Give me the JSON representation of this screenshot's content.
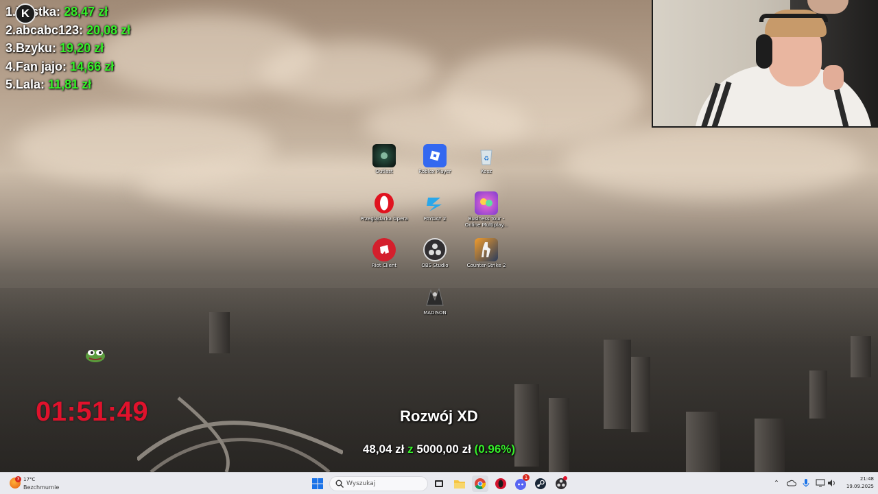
{
  "leaderboard": [
    {
      "rank": "1.",
      "name": "Nastka:",
      "amount": "28,47 zł"
    },
    {
      "rank": "2.",
      "name": "abcabc123:",
      "amount": "20,08 zł"
    },
    {
      "rank": "3.",
      "name": "Bzyku:",
      "amount": "19,20 zł"
    },
    {
      "rank": "4.",
      "name": "Fan jajo:",
      "amount": "14,66 zł"
    },
    {
      "rank": "5.",
      "name": "Lala:",
      "amount": "11,81 zł"
    }
  ],
  "overlay_logo": "K",
  "desktop_icons": [
    {
      "label": "Outlast",
      "icon": "outlast-icon"
    },
    {
      "label": "Roblox Player",
      "icon": "roblox-icon"
    },
    {
      "label": "Kosz",
      "icon": "recycle-bin-icon"
    },
    {
      "label": "Przeglądarka Opera",
      "icon": "opera-icon"
    },
    {
      "label": "PAYDAY 2",
      "icon": "payday-icon"
    },
    {
      "label": "Business Tour - Online Multiplay...",
      "icon": "business-tour-icon"
    },
    {
      "label": "Riot Client",
      "icon": "riot-icon"
    },
    {
      "label": "OBS Studio",
      "icon": "obs-icon"
    },
    {
      "label": "Counter-Strike 2",
      "icon": "counter-strike-icon"
    },
    {
      "label": "MADISON",
      "icon": "madison-icon"
    }
  ],
  "timer": "01:51:49",
  "goal": {
    "title": "Rozwój XD",
    "current": "48,04 zł",
    "separator": "z",
    "target": "5000,00 zł",
    "percent": "(0.96%)"
  },
  "taskbar": {
    "weather": {
      "badge": "3",
      "temp": "17°C",
      "desc": "Bezchmurnie"
    },
    "search_placeholder": "Wyszukaj",
    "apps": [
      "start-icon",
      "task-view-icon",
      "file-explorer-icon",
      "chrome-icon",
      "opera-gx-icon",
      "discord-icon",
      "steam-icon",
      "obs-icon"
    ],
    "discord_badge": "1",
    "time": "21:48",
    "date": "19.09.2025"
  },
  "colors": {
    "accent_green": "#36ef2a",
    "timer_red": "#e0122c",
    "taskbar_bg": "#e9eaef"
  }
}
